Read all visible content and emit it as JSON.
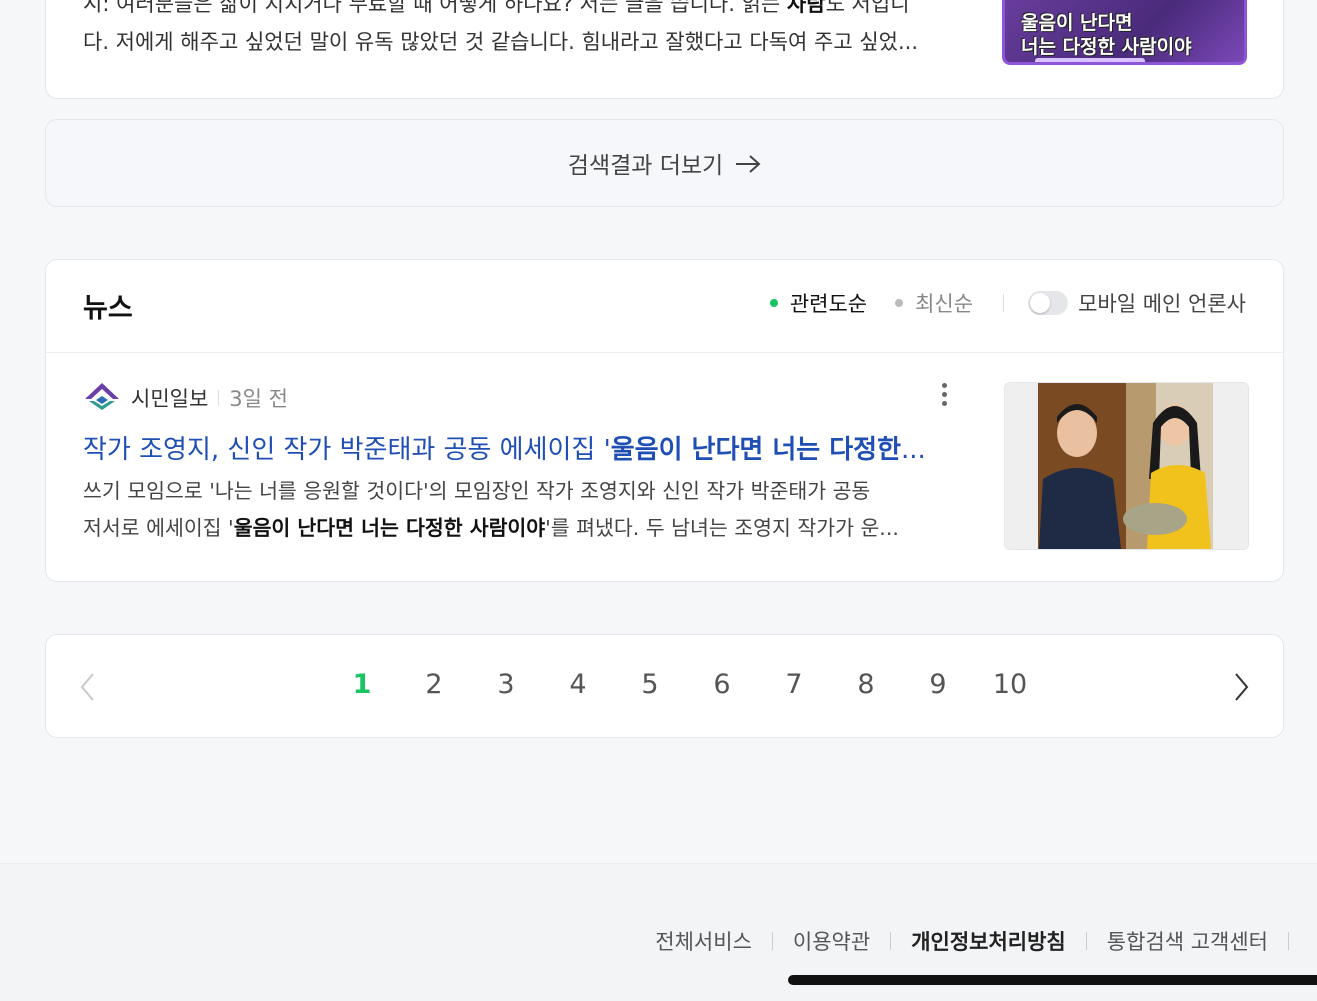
{
  "top_result": {
    "line1_pre": "시: 여러분들은 삶이 지치거나 무료할 때 어떻게 하나요? 저는 글을 씁니다. 읽는 ",
    "line1_bold": "사람",
    "line1_post": "도 저입니",
    "line2": "다. 저에게 해주고 싶었던 말이 유독 많았던 것 같습니다. 힘내라고 잘했다고 다독여 주고 싶었...",
    "thumb_line1": "울음이 난다면",
    "thumb_line2": "너는 다정한 사람이야"
  },
  "more_results": {
    "label": "검색결과 더보기"
  },
  "news": {
    "section_title": "뉴스",
    "sort_options": [
      "관련도순",
      "최신순"
    ],
    "mobile_toggle_label": "모바일 메인 언론사",
    "colors": {
      "active_dot": "#19c463",
      "inactive_dot": "#bbbbbb",
      "headline": "#1f4fb5"
    },
    "items": [
      {
        "press": "시민일보",
        "time": "3일 전",
        "headline_pre": "작가 조영지, 신인 작가 박준태과 공동 에세이집 '",
        "headline_bold": "울음이 난다면 너는 다정한",
        "headline_post": "...",
        "desc_line1": "쓰기 모임으로 '나는 너를 응원할 것이다'의 모임장인 작가 조영지와 신인 작가 박준태가 공동",
        "desc_line2_pre": "저서로 에세이집 '",
        "desc_line2_bold": "울음이 난다면 너는 다정한 사람이야",
        "desc_line2_post": "'를 펴냈다. 두 남녀는 조영지 작가가 운..."
      }
    ]
  },
  "pagination": {
    "current": "1",
    "pages": [
      "1",
      "2",
      "3",
      "4",
      "5",
      "6",
      "7",
      "8",
      "9",
      "10"
    ],
    "active_color": "#19c463"
  },
  "footer": {
    "links": [
      "전체서비스",
      "이용약관",
      "개인정보처리방침",
      "통합검색 고객센터"
    ]
  }
}
